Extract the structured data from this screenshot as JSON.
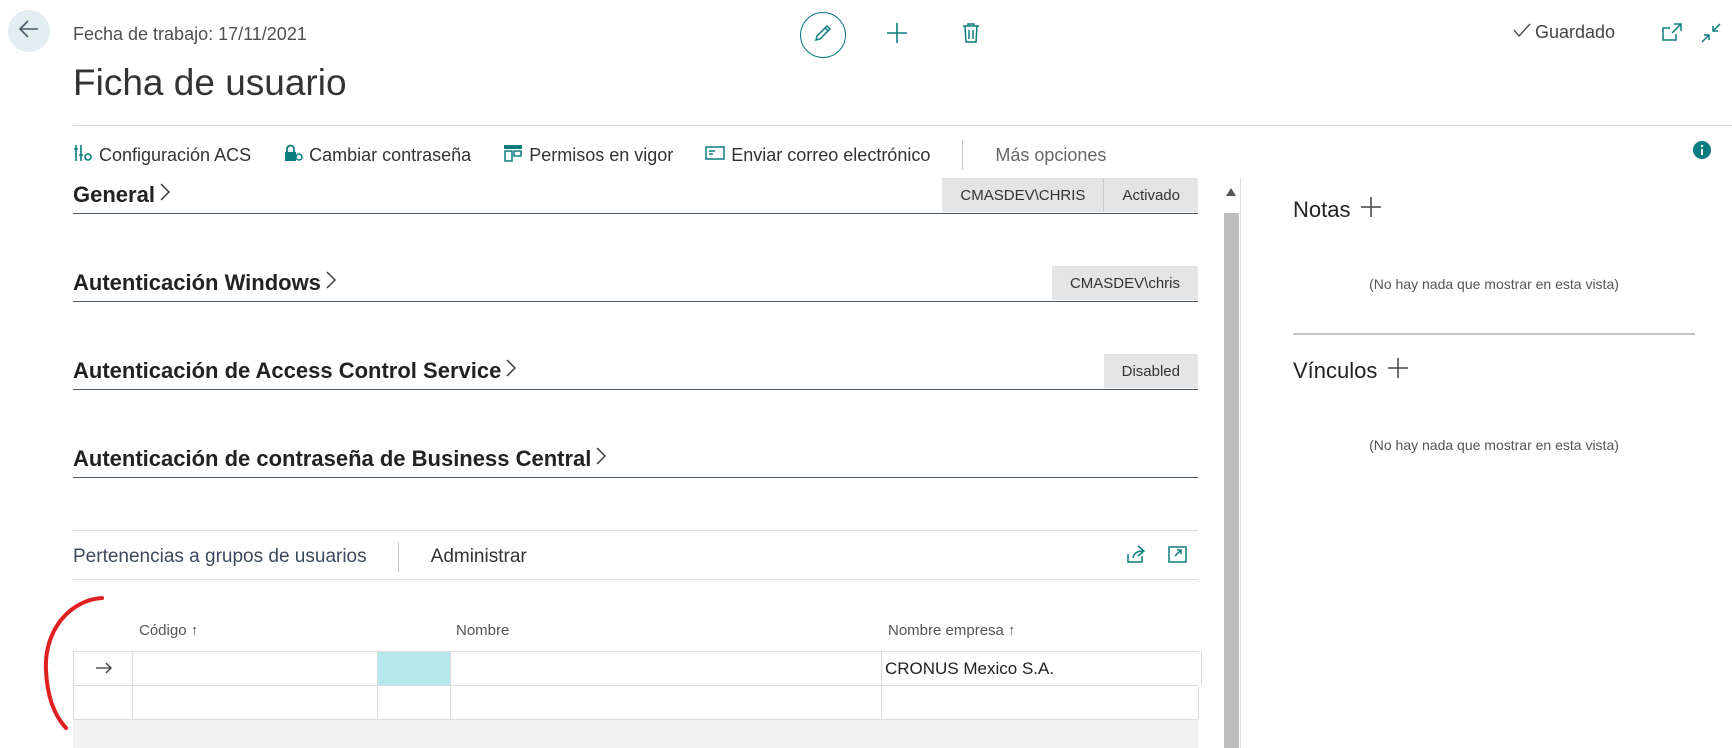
{
  "header": {
    "work_date": "Fecha de trabajo: 17/11/2021",
    "title": "Ficha de usuario",
    "saved_label": "Guardado"
  },
  "actions": [
    {
      "label": "Configuración ACS",
      "icon": "config-icon"
    },
    {
      "label": "Cambiar contraseña",
      "icon": "lock-icon"
    },
    {
      "label": "Permisos en vigor",
      "icon": "permissions-icon"
    },
    {
      "label": "Enviar correo electrónico",
      "icon": "email-icon"
    }
  ],
  "more_options": "Más opciones",
  "sections": {
    "general": {
      "title": "General",
      "chips": [
        "CMASDEV\\CHRIS",
        "Activado"
      ]
    },
    "windows": {
      "title": "Autenticación Windows",
      "chips": [
        "CMASDEV\\chris"
      ]
    },
    "acs": {
      "title": "Autenticación de Access Control Service",
      "chips": [
        "Disabled"
      ]
    },
    "bc_password": {
      "title": "Autenticación de contraseña de Business Central"
    }
  },
  "part": {
    "title": "Pertenencias a grupos de usuarios",
    "manage": "Administrar",
    "columns": {
      "code": "Código ↑",
      "name": "Nombre",
      "company": "Nombre empresa ↑"
    },
    "rows": [
      {
        "code": "",
        "name": "",
        "company": "CRONUS Mexico S.A."
      },
      {
        "code": "",
        "name": "",
        "company": ""
      }
    ]
  },
  "factbox": {
    "notes": {
      "title": "Notas",
      "empty": "(No hay nada que mostrar en esta vista)"
    },
    "links": {
      "title": "Vínculos",
      "empty": "(No hay nada que mostrar en esta vista)"
    }
  },
  "colors": {
    "accent": "#0b7c80",
    "selected_cell": "#b4e8ec",
    "annotation": "#e02020"
  }
}
